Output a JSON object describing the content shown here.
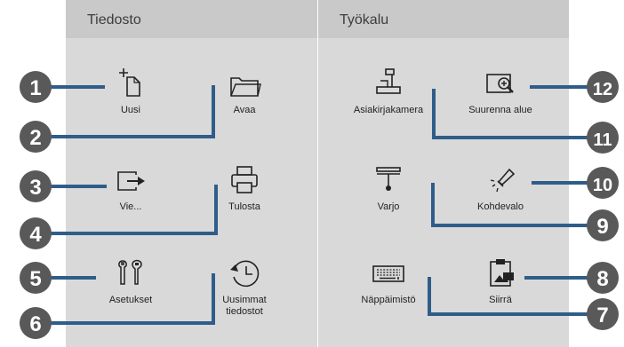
{
  "colors": {
    "panel": "#d9d9d9",
    "header": "#c9c9c9",
    "callout_circle": "#595959",
    "callout_line": "#2f5d8a"
  },
  "file_panel": {
    "title": "Tiedosto",
    "items": [
      {
        "label": "Uusi",
        "icon": "new-document-icon",
        "callout": "1"
      },
      {
        "label": "Avaa",
        "icon": "folder-icon",
        "callout": "2"
      },
      {
        "label": "Vie...",
        "icon": "export-icon",
        "callout": "3"
      },
      {
        "label": "Tulosta",
        "icon": "printer-icon",
        "callout": "4"
      },
      {
        "label": "Asetukset",
        "icon": "tools-icon",
        "callout": "5"
      },
      {
        "label_line1": "Uusimmat",
        "label_line2": "tiedostot",
        "icon": "recent-files-icon",
        "callout": "6"
      }
    ]
  },
  "tool_panel": {
    "title": "Työkalu",
    "items": [
      {
        "label": "Asiakirjakamera",
        "icon": "document-camera-icon",
        "callout": "11"
      },
      {
        "label": "Suurenna alue",
        "icon": "zoom-area-icon",
        "callout": "12"
      },
      {
        "label": "Varjo",
        "icon": "shade-icon",
        "callout": "9"
      },
      {
        "label": "Kohdevalo",
        "icon": "spotlight-icon",
        "callout": "10"
      },
      {
        "label": "Näppäimistö",
        "icon": "keyboard-icon",
        "callout": "7"
      },
      {
        "label": "Siirrä",
        "icon": "transfer-image-icon",
        "callout": "8"
      }
    ]
  }
}
